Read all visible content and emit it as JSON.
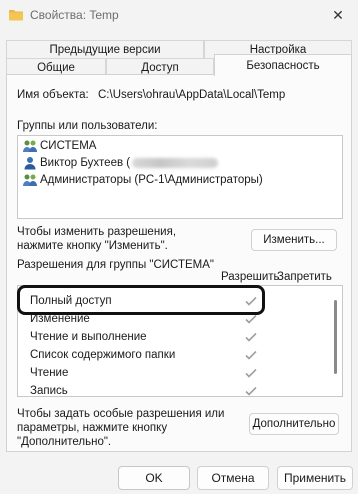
{
  "window": {
    "title": "Свойства: Temp"
  },
  "tabs": {
    "row_back": [
      "Предыдущие версии",
      "Настройка"
    ],
    "row_front": [
      "Общие",
      "Доступ",
      "Безопасность"
    ]
  },
  "object": {
    "label": "Имя объекта:",
    "value": "C:\\Users\\ohrau\\AppData\\Local\\Temp"
  },
  "groups": {
    "label": "Группы или пользователи:",
    "items": [
      {
        "name": "СИСТЕМА"
      },
      {
        "name": "Виктор Бухтеев ("
      },
      {
        "name": "Администраторы (PC-1\\Администраторы)"
      }
    ]
  },
  "change": {
    "hint": "Чтобы изменить разрешения,\nнажмите кнопку \"Изменить\".",
    "hint_line1": "Чтобы изменить разрешения,",
    "hint_line2": "нажмите кнопку \"Изменить\".",
    "button": "Изменить..."
  },
  "permissions": {
    "label": "Разрешения для группы \"СИСТЕМА\"",
    "allow_header": "Разрешить",
    "deny_header": "Запретить",
    "rows": [
      {
        "name": "Полный доступ",
        "allow": true,
        "deny": false
      },
      {
        "name": "Изменение",
        "allow": true,
        "deny": false
      },
      {
        "name": "Чтение и выполнение",
        "allow": true,
        "deny": false
      },
      {
        "name": "Список содержимого папки",
        "allow": true,
        "deny": false
      },
      {
        "name": "Чтение",
        "allow": true,
        "deny": false
      },
      {
        "name": "Запись",
        "allow": true,
        "deny": false
      }
    ]
  },
  "advanced": {
    "hint_line1": "Чтобы задать особые разрешения или",
    "hint_line2": "параметры, нажмите кнопку",
    "hint_line3": "\"Дополнительно\".",
    "button": "Дополнительно"
  },
  "footer": {
    "ok": "OK",
    "cancel": "Отмена",
    "apply": "Применить"
  },
  "colors": {
    "check": "#9e9e9e",
    "highlight_border": "#111111",
    "folder": "#e8b84a"
  }
}
